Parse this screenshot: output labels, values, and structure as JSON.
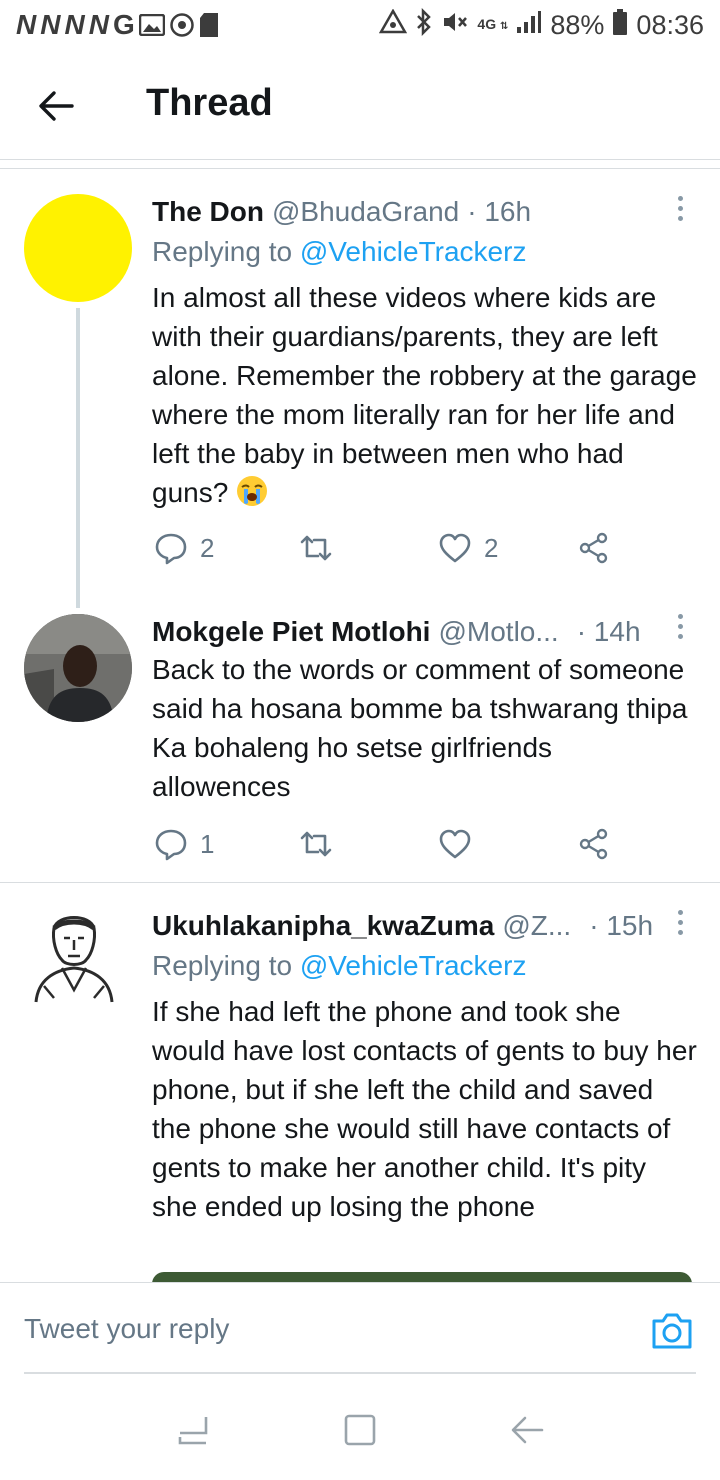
{
  "status_bar": {
    "left_letters": [
      "N",
      "N",
      "N",
      "N",
      "G"
    ],
    "battery": "88%",
    "time": "08:36",
    "network": "4G"
  },
  "header": {
    "title": "Thread"
  },
  "tweets": [
    {
      "name": "The Don",
      "handle": "@BhudaGrand",
      "time": "· 16h",
      "replying_prefix": "Replying to",
      "replying_to": "@VehicleTrackerz",
      "text": "In almost all these videos where kids are with their guardians/parents, they are left alone. Remember the robbery at the garage where the mom literally ran for her life and left the baby in between men who had guns?",
      "emoji": "crying-face",
      "replies": "2",
      "retweets": "",
      "likes": "2",
      "avatar_color": "#fff200"
    },
    {
      "name": "Mokgele Piet Motlohi",
      "handle": "@Motlo...",
      "time": "· 14h",
      "text": "Back to the words or comment of someone said ha hosana bomme ba tshwarang thipa Ka bohaleng ho setse girlfriends allowences",
      "replies": "1",
      "retweets": "",
      "likes": ""
    },
    {
      "name": "Ukuhlakanipha_kwaZuma",
      "handle": "@Z...",
      "time": "· 15h",
      "replying_prefix": "Replying to",
      "replying_to": "@VehicleTrackerz",
      "text": "If she had left the phone and took she would have lost contacts of gents to buy her phone, but if she left the child and saved the phone she would still have contacts of gents to make her another child. It's pity she ended up losing the phone"
    }
  ],
  "reply_bar": {
    "placeholder": "Tweet your reply"
  },
  "colors": {
    "accent": "#1da1f2",
    "secondary_text": "#657786",
    "border": "#d9dde0"
  }
}
